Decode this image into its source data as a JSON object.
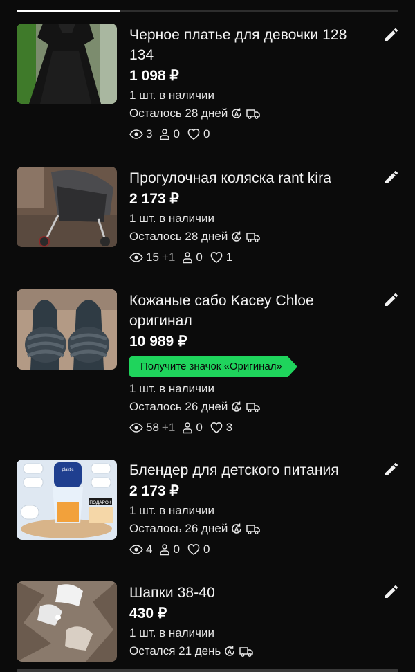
{
  "listings": [
    {
      "title": "Черное платье для девочки 128 134",
      "price": "1 098 ₽",
      "stock": "1 шт. в наличии",
      "remaining": "Осталось 28 дней",
      "views": "3",
      "views_extra": "",
      "contacts": "0",
      "likes": "0",
      "badge": ""
    },
    {
      "title": "Прогулочная коляска rant kira",
      "price": "2 173 ₽",
      "stock": "1 шт. в наличии",
      "remaining": "Осталось 28 дней",
      "views": "15",
      "views_extra": "+1",
      "contacts": "0",
      "likes": "1",
      "badge": ""
    },
    {
      "title": "Кожаные сабо Kacey Chloe оригинал",
      "price": "10 989 ₽",
      "stock": "1 шт. в наличии",
      "remaining": "Осталось 26 дней",
      "views": "58",
      "views_extra": "+1",
      "contacts": "0",
      "likes": "3",
      "badge": "Получите значок «Оригинал»"
    },
    {
      "title": "Блендер для детского питания",
      "price": "2 173 ₽",
      "stock": "1 шт. в наличии",
      "remaining": "Осталось 26 дней",
      "views": "4",
      "views_extra": "",
      "contacts": "0",
      "likes": "0",
      "badge": "",
      "thumb_text": {
        "brand": "plaktic",
        "label": "ПОДАРОК"
      }
    },
    {
      "title": "Шапки 38-40",
      "price": "430 ₽",
      "stock": "1 шт. в наличии",
      "remaining": "Остался 21 день",
      "badge": ""
    }
  ],
  "icons": {
    "edit": "pencil-icon",
    "views": "eye-icon",
    "contacts": "person-icon",
    "likes": "heart-icon",
    "autoprolong": "auto-renew-icon",
    "delivery": "truck-icon"
  },
  "colors": {
    "background": "#0b0b0b",
    "badge": "#1fd45c",
    "muted": "#8a8a8a"
  }
}
